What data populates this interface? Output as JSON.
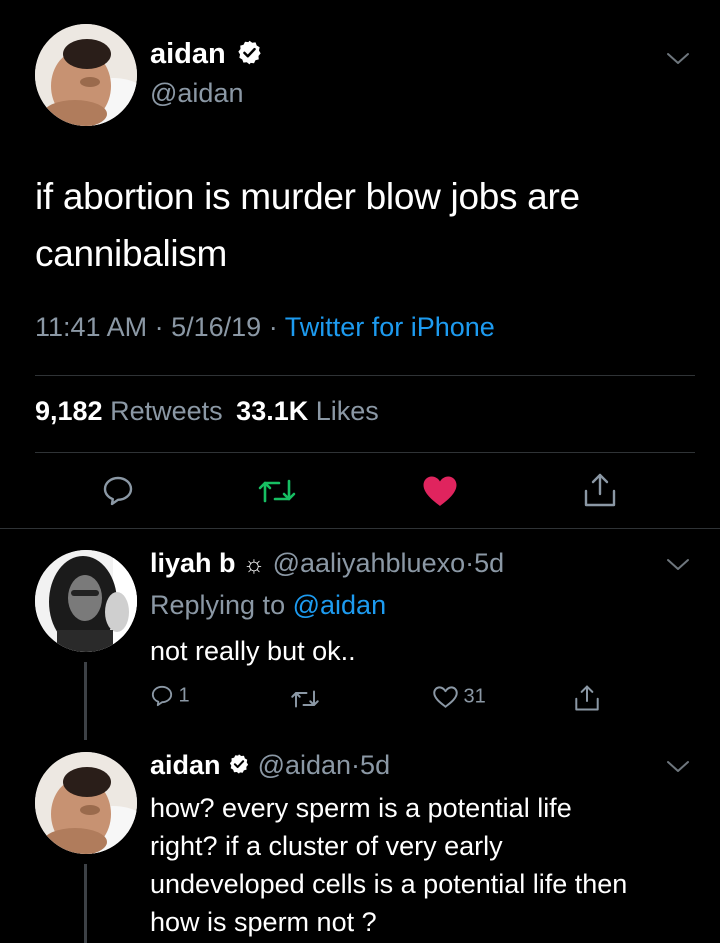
{
  "colors": {
    "background": "#000000",
    "text": "#ffffff",
    "secondary": "#8b98a5",
    "link": "#1d9bf0",
    "retweet": "#17bf63",
    "like": "#e0245e"
  },
  "main_tweet": {
    "display_name": "aidan",
    "handle": "@aidan",
    "text_line1": "if abortion is murder blow jobs are",
    "text_line2": "cannibalism",
    "time": "11:41 AM",
    "date": "5/16/19",
    "separator": "·",
    "source": "Twitter for iPhone",
    "retweets_count": "9,182",
    "retweets_label": "Retweets",
    "likes_count": "33.1K",
    "likes_label": "Likes",
    "icons": [
      "reply-icon",
      "retweet-icon",
      "like-icon",
      "share-icon"
    ]
  },
  "reply1": {
    "display_name": "liyah b",
    "name_emoji": "☼",
    "handle": "@aaliyahbluexo",
    "separator": "·",
    "age": "5d",
    "replying_prefix": "Replying to",
    "replying_handle": "@aidan",
    "text": "not really but ok..",
    "reply_count": "1",
    "like_count": "31"
  },
  "reply2": {
    "display_name": "aidan",
    "handle": "@aidan",
    "separator": "·",
    "age": "5d",
    "text_line1": "how? every sperm is a potential life",
    "text_line2": "right? if a cluster of very early",
    "text_line3": "undeveloped cells is a potential life then",
    "text_line4": "how is sperm not ?"
  }
}
